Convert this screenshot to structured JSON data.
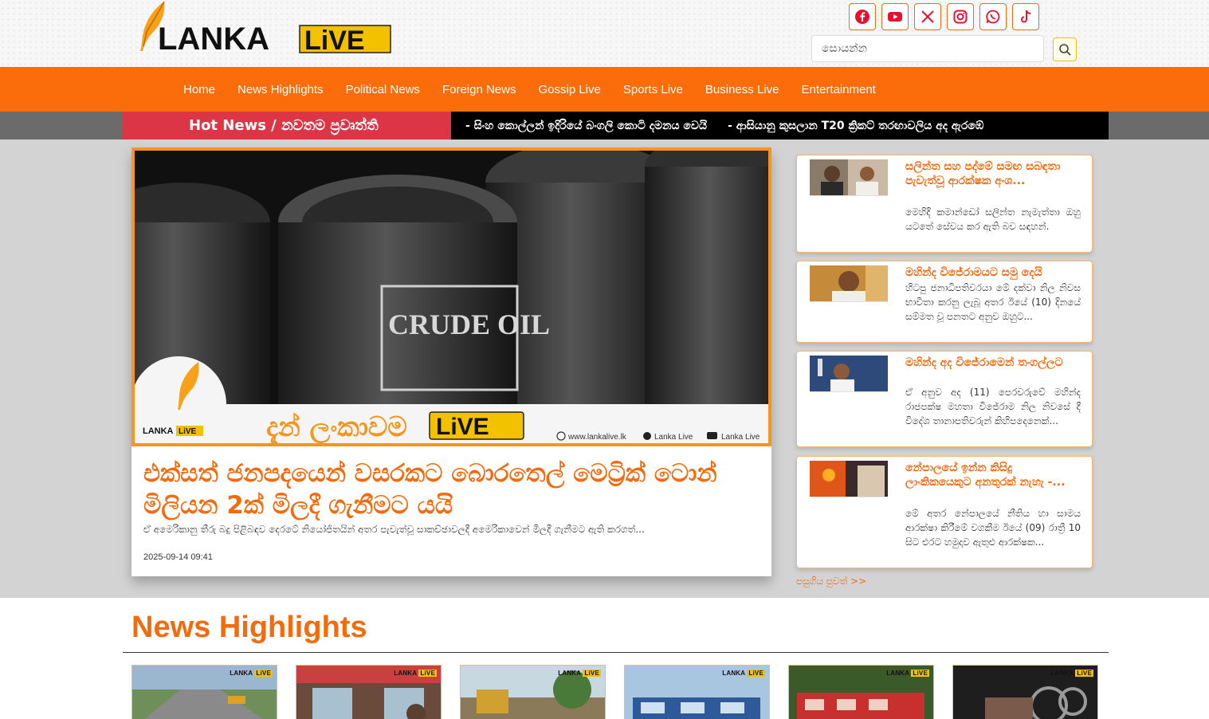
{
  "header": {
    "logo": {
      "word1": "LANKA",
      "word2": "LiVE"
    },
    "social": [
      {
        "name": "facebook",
        "icon": "facebook-icon"
      },
      {
        "name": "youtube",
        "icon": "youtube-icon"
      },
      {
        "name": "x",
        "icon": "x-icon"
      },
      {
        "name": "instagram",
        "icon": "instagram-icon"
      },
      {
        "name": "whatsapp",
        "icon": "whatsapp-icon"
      },
      {
        "name": "tiktok",
        "icon": "tiktok-icon"
      }
    ],
    "search": {
      "placeholder": "සොයන්න",
      "icon": "search-icon"
    }
  },
  "nav": {
    "items": [
      "Home",
      "News Highlights",
      "Political News",
      "Foreign News",
      "Gossip Live",
      "Sports Live",
      "Business Live",
      "Entertainment"
    ]
  },
  "ticker": {
    "label": "Hot News / නවතම ප්‍රවෘත්ති",
    "items": [
      "- සිංහ කොල්ලන් ඉදිරියේ බංගලි කොටි දමනය වෙයි",
      "- ආසියානු කුසලාන T20 ක්‍රිකට් තරඟාවලිය අද ඇරඹේ"
    ]
  },
  "featured": {
    "image_label": "CRUDE OIL",
    "banner_text": "දැන් ලංකාවම",
    "banner_live": "LiVE",
    "banner_site": "www.lankalive.lk",
    "banner_fb": "Lanka Live",
    "banner_yt": "Lanka Live",
    "title": "එක්සත් ජනපදයෙන් වසරකට බොරතෙල් මෙට්‍රික් ටොන් මිලියන 2ක් මිලදී ගැනීමට යයි",
    "summary": "ඒ අමෙරිකානු තීරු බදු පිළිබඳව දෙරටේ නියෝජිතයින් අතර පැවැත්වූ සාකච්ඡාවලදී අමෙරිකාවෙන් මිලදී ගැනීමට ඇති කරගත්...",
    "date": "2025-09-14 09:41"
  },
  "side_news": [
    {
      "title": "සලින්ත සහ පද්මේ සමඟ සබඳතා පැවැත්වූ ආරක්ෂක අංශ...",
      "text": "මෙහිදී කමාන්ඩෝ සලින්ත නැමැත්තා ඔහු යටතේ සේවය කර ඇති බව සඳහන්."
    },
    {
      "title": "මහින්ද විජේරාමයට සමු දෙයි",
      "text": "හිටපු ජනාධිපතිවරයා මේ දක්වා නිල නිවස භාවිතා කරනු ලැබූ අතර ඊයේ (10) දිනයේ සම්මත වූ පනතට අනුව ඔහුට..."
    },
    {
      "title": "මහින්ද අද විජේරාමෙන් තංගල්ලට",
      "text": "ඒ අනුව අද (11) පෙරවරුවේ මහින්ද රාජපක්ෂ මහතා විජේරාම නිල නිවසේ දී විදේශ තානාපතිවරුන් කිහිපදෙනෙක්..."
    },
    {
      "title": "නේපාලයේ ඉන්න කිසිදු ලාංකිකයෙකුට අනතුරක් නැහැ -...",
      "text": "මේ අතර නේපාලයේ නීතිය හා සාමය ආරක්ෂා කිරීමේ වගකීම ඊයේ (09) රාත්‍රී 10 සිට එරට හමුදාව ඇතුළු ආරක්ෂක..."
    }
  ],
  "more_link": "පසුගිය පුවත් >>",
  "highlights": {
    "title": "News Highlights",
    "cards": [
      {
        "thumb_logo": "LANKA",
        "thumb_live": "LiVE"
      },
      {
        "thumb_logo": "LANKA",
        "thumb_live": "LiVE"
      },
      {
        "thumb_logo": "LANKA",
        "thumb_live": "LiVE"
      },
      {
        "thumb_logo": "LANKA",
        "thumb_live": "LiVE"
      },
      {
        "thumb_logo": "LANKA",
        "thumb_live": "LiVE"
      },
      {
        "thumb_logo": "LANKA",
        "thumb_live": "LiVE"
      }
    ]
  },
  "colors": {
    "brand_orange": "#fb6d0a",
    "hot_red": "#dc3545",
    "accent_yellow": "#f2c100"
  }
}
